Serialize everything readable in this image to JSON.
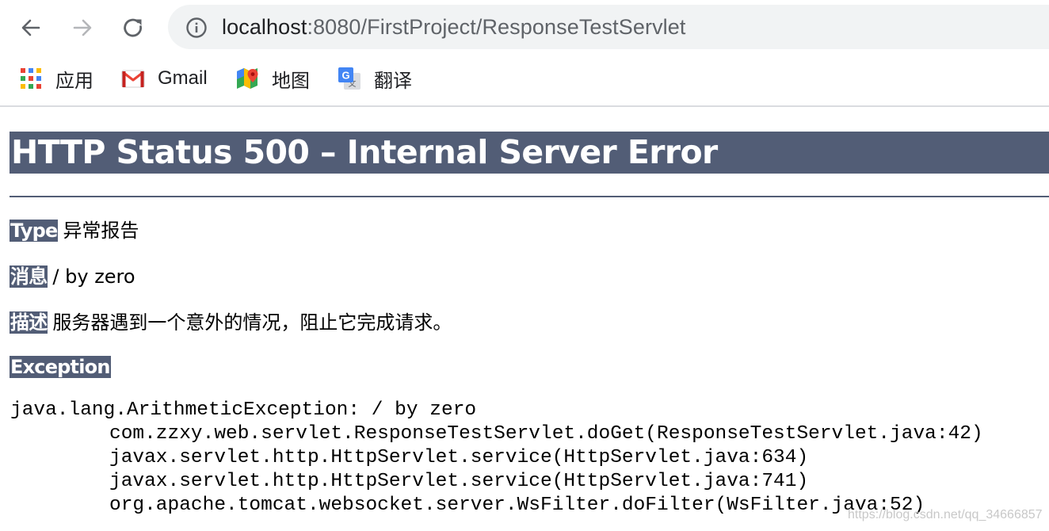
{
  "browser": {
    "url_host": "localhost",
    "url_path": ":8080/FirstProject/ResponseTestServlet",
    "icons": {
      "back": "arrow-left-icon",
      "forward": "arrow-right-icon",
      "reload": "reload-icon",
      "site_info": "info-circle-icon"
    },
    "bookmarks": [
      {
        "label": "应用",
        "icon": "apps-grid-icon"
      },
      {
        "label": "Gmail",
        "icon": "gmail-icon"
      },
      {
        "label": "地图",
        "icon": "maps-icon"
      },
      {
        "label": "翻译",
        "icon": "translate-icon"
      }
    ]
  },
  "page": {
    "title": "HTTP Status 500 – Internal Server Error",
    "type_label": "Type",
    "type_value": "异常报告",
    "message_label": "消息",
    "message_value": "/ by zero",
    "description_label": "描述",
    "description_value": "服务器遇到一个意外的情况，阻止它完成请求。",
    "exception_label": "Exception",
    "stack_trace": [
      "java.lang.ArithmeticException: / by zero",
      "com.zzxy.web.servlet.ResponseTestServlet.doGet(ResponseTestServlet.java:42)",
      "javax.servlet.http.HttpServlet.service(HttpServlet.java:634)",
      "javax.servlet.http.HttpServlet.service(HttpServlet.java:741)",
      "org.apache.tomcat.websocket.server.WsFilter.doFilter(WsFilter.java:52)"
    ]
  },
  "watermark": "https://blog.csdn.net/qq_34666857",
  "colors": {
    "tomcat_header": "#525d76",
    "omnibox_bg": "#f1f3f4",
    "chrome_icon": "#5f6368"
  }
}
